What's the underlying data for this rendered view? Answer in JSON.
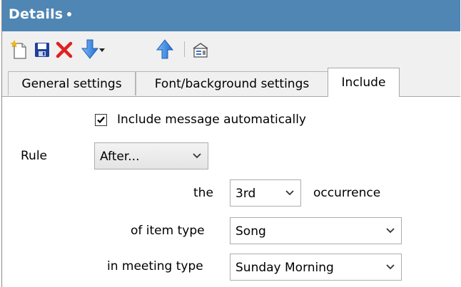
{
  "window": {
    "title": "Details"
  },
  "toolbar": {
    "buttons": [
      {
        "name": "new",
        "icon": "new-document-icon"
      },
      {
        "name": "save",
        "icon": "save-icon"
      },
      {
        "name": "delete",
        "icon": "delete-icon"
      },
      {
        "name": "move-down",
        "icon": "arrow-down-icon"
      },
      {
        "name": "move-down-menu",
        "icon": "dropdown-caret-icon"
      },
      {
        "name": "move-up",
        "icon": "arrow-up-icon"
      },
      {
        "name": "properties",
        "icon": "properties-icon"
      }
    ]
  },
  "tabs": [
    {
      "label": "General settings",
      "active": false
    },
    {
      "label": "Font/background settings",
      "active": false
    },
    {
      "label": "Include",
      "active": true
    }
  ],
  "include": {
    "auto_include_label": "Include message automatically",
    "auto_include_checked": true,
    "rule_label": "Rule",
    "rule_value": "After...",
    "the_label": "the",
    "occurrence_value": "3rd",
    "occurrence_label": "occurrence",
    "item_type_label": "of item type",
    "item_type_value": "Song",
    "meeting_type_label": "in meeting type",
    "meeting_type_value": "Sunday Morning"
  },
  "colors": {
    "titlebar": "#4f86b4",
    "title_text": "#ffffff",
    "delete_red": "#e02020",
    "arrow_blue": "#2f7fd8",
    "save_blue": "#1f3f9a"
  }
}
